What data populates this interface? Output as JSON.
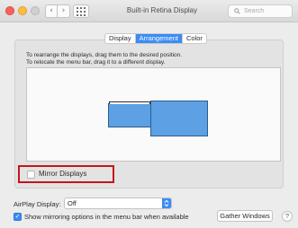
{
  "window": {
    "title": "Built-in Retina Display"
  },
  "toolbar": {
    "back_glyph": "‹",
    "forward_glyph": "›",
    "grid_icon": "grid-icon",
    "search_placeholder": "Search"
  },
  "tabs": [
    {
      "label": "Display",
      "active": false
    },
    {
      "label": "Arrangement",
      "active": true
    },
    {
      "label": "Color",
      "active": false
    }
  ],
  "arrangement": {
    "instruction_line1": "To rearrange the displays, drag them to the desired position.",
    "instruction_line2": "To relocate the menu bar, drag it to a different display."
  },
  "mirror": {
    "label": "Mirror Displays",
    "checked": false
  },
  "airplay": {
    "label": "AirPlay Display:",
    "value": "Off"
  },
  "show_mirroring": {
    "label": "Show mirroring options in the menu bar when available",
    "checked": true,
    "check_glyph": "✓"
  },
  "buttons": {
    "gather": "Gather Windows",
    "help": "?"
  },
  "colors": {
    "accent": "#3b8cf5",
    "display_fill": "#5da0e3",
    "highlight_border": "#c4161c"
  }
}
